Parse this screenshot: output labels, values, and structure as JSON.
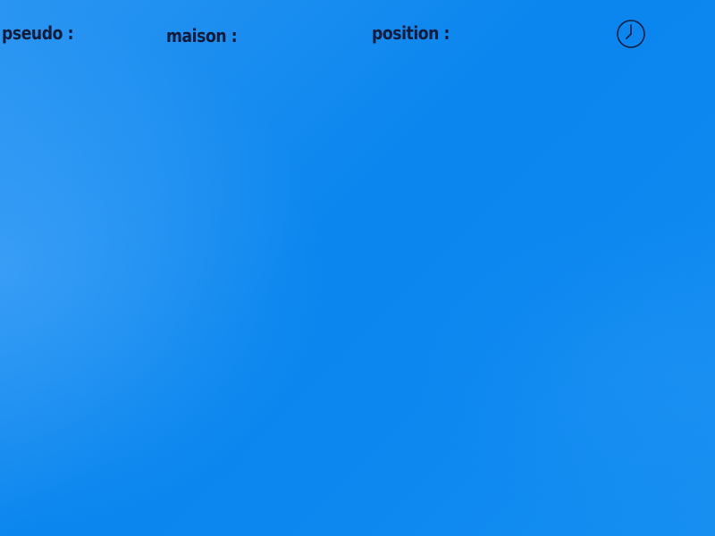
{
  "header": {
    "pseudo_label": "pseudo :",
    "maison_label": "maison :",
    "position_label": "position :",
    "clock_icon": "clock-icon"
  },
  "colors": {
    "background": "#0a86ee",
    "background_light": "#3a9ff3",
    "text": "#151b3b"
  }
}
